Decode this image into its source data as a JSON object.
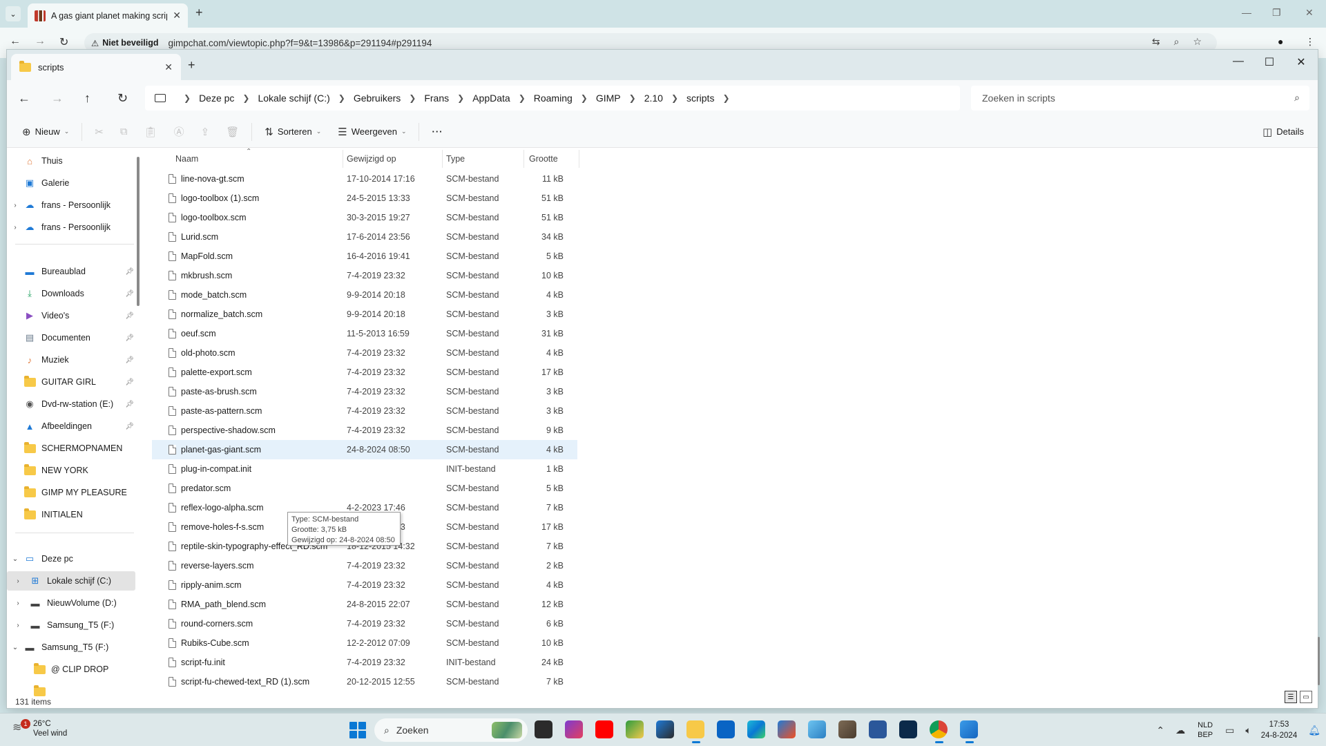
{
  "browser": {
    "tab_title": "A gas giant planet making scrip",
    "security_label": "Niet beveiligd",
    "url": "gimpchat.com/viewtopic.php?f=9&t=13986&p=291194#p291194"
  },
  "explorer": {
    "tab_title": "scripts",
    "breadcrumb": [
      "Deze pc",
      "Lokale schijf (C:)",
      "Gebruikers",
      "Frans",
      "AppData",
      "Roaming",
      "GIMP",
      "2.10",
      "scripts"
    ],
    "search_placeholder": "Zoeken in scripts",
    "toolbar": {
      "new_label": "Nieuw",
      "sort_label": "Sorteren",
      "view_label": "Weergeven",
      "more_label": "···",
      "details_label": "Details"
    },
    "nav": {
      "home": "Thuis",
      "gallery": "Galerie",
      "onedrive1": "frans - Persoonlijk",
      "onedrive2": "frans - Persoonlijk",
      "quick": [
        "Bureaublad",
        "Downloads",
        "Video's",
        "Documenten",
        "Muziek",
        "GUITAR GIRL",
        "Dvd-rw-station (E:)",
        "Afbeeldingen",
        "SCHERMOPNAMEN",
        "NEW YORK",
        "GIMP MY PLEASURE",
        "INITIALEN"
      ],
      "this_pc": "Deze pc",
      "drives": [
        "Lokale schijf (C:)",
        "NieuwVolume (D:)",
        "Samsung_T5 (F:)",
        "Samsung_T5 (F:)",
        "@ CLIP DROP"
      ]
    },
    "columns": {
      "name": "Naam",
      "modified": "Gewijzigd op",
      "type": "Type",
      "size": "Grootte"
    },
    "files": [
      {
        "name": "line-nova-gt.scm",
        "date": "17-10-2014 17:16",
        "type": "SCM-bestand",
        "size": "11 kB"
      },
      {
        "name": "logo-toolbox (1).scm",
        "date": "24-5-2015 13:33",
        "type": "SCM-bestand",
        "size": "51 kB"
      },
      {
        "name": "logo-toolbox.scm",
        "date": "30-3-2015 19:27",
        "type": "SCM-bestand",
        "size": "51 kB"
      },
      {
        "name": "Lurid.scm",
        "date": "17-6-2014 23:56",
        "type": "SCM-bestand",
        "size": "34 kB"
      },
      {
        "name": "MapFold.scm",
        "date": "16-4-2016 19:41",
        "type": "SCM-bestand",
        "size": "5 kB"
      },
      {
        "name": "mkbrush.scm",
        "date": "7-4-2019 23:32",
        "type": "SCM-bestand",
        "size": "10 kB"
      },
      {
        "name": "mode_batch.scm",
        "date": "9-9-2014 20:18",
        "type": "SCM-bestand",
        "size": "4 kB"
      },
      {
        "name": "normalize_batch.scm",
        "date": "9-9-2014 20:18",
        "type": "SCM-bestand",
        "size": "3 kB"
      },
      {
        "name": "oeuf.scm",
        "date": "11-5-2013 16:59",
        "type": "SCM-bestand",
        "size": "31 kB"
      },
      {
        "name": "old-photo.scm",
        "date": "7-4-2019 23:32",
        "type": "SCM-bestand",
        "size": "4 kB"
      },
      {
        "name": "palette-export.scm",
        "date": "7-4-2019 23:32",
        "type": "SCM-bestand",
        "size": "17 kB"
      },
      {
        "name": "paste-as-brush.scm",
        "date": "7-4-2019 23:32",
        "type": "SCM-bestand",
        "size": "3 kB"
      },
      {
        "name": "paste-as-pattern.scm",
        "date": "7-4-2019 23:32",
        "type": "SCM-bestand",
        "size": "3 kB"
      },
      {
        "name": "perspective-shadow.scm",
        "date": "7-4-2019 23:32",
        "type": "SCM-bestand",
        "size": "9 kB"
      },
      {
        "name": "planet-gas-giant.scm",
        "date": "24-8-2024 08:50",
        "type": "SCM-bestand",
        "size": "4 kB"
      },
      {
        "name": "plug-in-compat.init",
        "date": "",
        "type": "INIT-bestand",
        "size": "1 kB"
      },
      {
        "name": "predator.scm",
        "date": "",
        "type": "SCM-bestand",
        "size": "5 kB"
      },
      {
        "name": "reflex-logo-alpha.scm",
        "date": "4-2-2023 17:46",
        "type": "SCM-bestand",
        "size": "7 kB"
      },
      {
        "name": "remove-holes-f-s.scm",
        "date": "6-5-2014 01:43",
        "type": "SCM-bestand",
        "size": "17 kB"
      },
      {
        "name": "reptile-skin-typography-effect_RD.scm",
        "date": "18-12-2015 14:32",
        "type": "SCM-bestand",
        "size": "7 kB"
      },
      {
        "name": "reverse-layers.scm",
        "date": "7-4-2019 23:32",
        "type": "SCM-bestand",
        "size": "2 kB"
      },
      {
        "name": "ripply-anim.scm",
        "date": "7-4-2019 23:32",
        "type": "SCM-bestand",
        "size": "4 kB"
      },
      {
        "name": "RMA_path_blend.scm",
        "date": "24-8-2015 22:07",
        "type": "SCM-bestand",
        "size": "12 kB"
      },
      {
        "name": "round-corners.scm",
        "date": "7-4-2019 23:32",
        "type": "SCM-bestand",
        "size": "6 kB"
      },
      {
        "name": "Rubiks-Cube.scm",
        "date": "12-2-2012 07:09",
        "type": "SCM-bestand",
        "size": "10 kB"
      },
      {
        "name": "script-fu.init",
        "date": "7-4-2019 23:32",
        "type": "INIT-bestand",
        "size": "24 kB"
      },
      {
        "name": "script-fu-chewed-text_RD (1).scm",
        "date": "20-12-2015 12:55",
        "type": "SCM-bestand",
        "size": "7 kB"
      }
    ],
    "tooltip": {
      "line1": "Type: SCM-bestand",
      "line2": "Grootte: 3,75 kB",
      "line3": "Gewijzigd op: 24-8-2024 08:50"
    },
    "status": "131 items"
  },
  "taskbar": {
    "temperature": "26°C",
    "weather": "Veel wind",
    "weather_badge": "1",
    "search_label": "Zoeken",
    "lang_top": "NLD",
    "lang_bottom": "BEP",
    "time": "17:53",
    "date": "24-8-2024"
  }
}
